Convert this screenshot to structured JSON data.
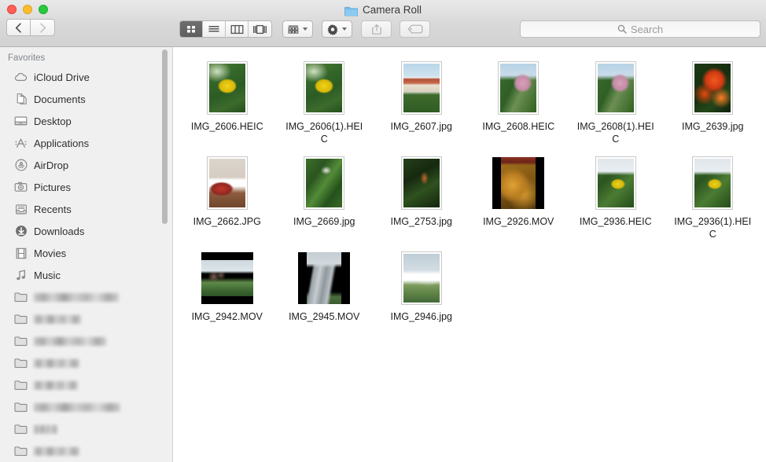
{
  "window": {
    "title": "Camera Roll",
    "title_icon": "folder-icon",
    "traffic_lights": [
      {
        "name": "close-button",
        "color": "#ff5f57"
      },
      {
        "name": "minimize-button",
        "color": "#ffbd2e"
      },
      {
        "name": "zoom-button",
        "color": "#28c940"
      }
    ]
  },
  "toolbar": {
    "back_label": "‹",
    "forward_label": "›",
    "view_modes": [
      {
        "name": "icon-view",
        "icon": "grid-icon",
        "active": true
      },
      {
        "name": "list-view",
        "icon": "list-icon",
        "active": false
      },
      {
        "name": "column-view",
        "icon": "columns-icon",
        "active": false
      },
      {
        "name": "gallery-view",
        "icon": "coverflow-icon",
        "active": false
      }
    ],
    "arrange": {
      "name": "arrange-button",
      "icon": "arrange-icon"
    },
    "action": {
      "name": "action-button",
      "icon": "gear-icon"
    },
    "share": {
      "name": "share-button",
      "icon": "share-icon"
    },
    "tags": {
      "name": "tags-button",
      "icon": "tag-icon"
    }
  },
  "search": {
    "placeholder": "Search",
    "value": "",
    "icon": "search-icon"
  },
  "sidebar": {
    "section_title": "Favorites",
    "items": [
      {
        "label": "iCloud Drive",
        "icon": "cloud-icon",
        "redacted": false
      },
      {
        "label": "Documents",
        "icon": "documents-icon",
        "redacted": false
      },
      {
        "label": "Desktop",
        "icon": "desktop-icon",
        "redacted": false
      },
      {
        "label": "Applications",
        "icon": "applications-icon",
        "redacted": false
      },
      {
        "label": "AirDrop",
        "icon": "airdrop-icon",
        "redacted": false
      },
      {
        "label": "Pictures",
        "icon": "pictures-icon",
        "redacted": false
      },
      {
        "label": "Recents",
        "icon": "recents-icon",
        "redacted": false
      },
      {
        "label": "Downloads",
        "icon": "downloads-icon",
        "redacted": false
      },
      {
        "label": "Movies",
        "icon": "movies-icon",
        "redacted": false
      },
      {
        "label": "Music",
        "icon": "music-icon",
        "redacted": false
      },
      {
        "label": "",
        "icon": "folder-icon",
        "redacted": true,
        "redacted_width": 108
      },
      {
        "label": "",
        "icon": "folder-icon",
        "redacted": true,
        "redacted_width": 60
      },
      {
        "label": "",
        "icon": "folder-icon",
        "redacted": true,
        "redacted_width": 92
      },
      {
        "label": "",
        "icon": "folder-icon",
        "redacted": true,
        "redacted_width": 58
      },
      {
        "label": "",
        "icon": "folder-icon",
        "redacted": true,
        "redacted_width": 56
      },
      {
        "label": "",
        "icon": "folder-icon",
        "redacted": true,
        "redacted_width": 110
      },
      {
        "label": "",
        "icon": "folder-icon",
        "redacted": true,
        "redacted_width": 30
      },
      {
        "label": "",
        "icon": "folder-icon",
        "redacted": true,
        "redacted_width": 58
      }
    ]
  },
  "files": [
    {
      "name": "IMG_2606.HEIC",
      "kind": "image",
      "orient": "portrait",
      "scene": "yellow-flower-plant"
    },
    {
      "name": "IMG_2606(1).HEIC",
      "kind": "image",
      "orient": "portrait",
      "scene": "yellow-flower-plant"
    },
    {
      "name": "IMG_2607.jpg",
      "kind": "image",
      "orient": "portrait",
      "scene": "red-roof-building"
    },
    {
      "name": "IMG_2608.HEIC",
      "kind": "image",
      "orient": "portrait",
      "scene": "pink-flower-sky"
    },
    {
      "name": "IMG_2608(1).HEIC",
      "kind": "image",
      "orient": "portrait",
      "scene": "pink-flower-sky"
    },
    {
      "name": "IMG_2639.jpg",
      "kind": "image",
      "orient": "portrait",
      "scene": "red-orange-flowers"
    },
    {
      "name": "IMG_2662.JPG",
      "kind": "image",
      "orient": "portrait",
      "scene": "indoor-person"
    },
    {
      "name": "IMG_2669.jpg",
      "kind": "image",
      "orient": "portrait",
      "scene": "jungle-foliage"
    },
    {
      "name": "IMG_2753.jpg",
      "kind": "image",
      "orient": "portrait",
      "scene": "dark-jungle"
    },
    {
      "name": "IMG_2926.MOV",
      "kind": "video",
      "orient": "portrait",
      "scene": "golden-teddy-bears"
    },
    {
      "name": "IMG_2936.HEIC",
      "kind": "image",
      "orient": "portrait",
      "scene": "yellow-blossom"
    },
    {
      "name": "IMG_2936(1).HEIC",
      "kind": "image",
      "orient": "portrait",
      "scene": "yellow-blossom"
    },
    {
      "name": "IMG_2942.MOV",
      "kind": "video",
      "orient": "landscape",
      "scene": "gardens-by-the-bay"
    },
    {
      "name": "IMG_2945.MOV",
      "kind": "video",
      "orient": "portrait",
      "scene": "marina-bay-sands"
    },
    {
      "name": "IMG_2946.jpg",
      "kind": "image",
      "orient": "portrait",
      "scene": "ferris-wheel-park"
    }
  ],
  "colors": {
    "folder_blue": "#6eb8ea",
    "toolbar_bg": "#d8d8d8",
    "sidebar_bg": "#f0f0f0",
    "content_bg": "#ffffff",
    "active_segment": "#646464"
  }
}
